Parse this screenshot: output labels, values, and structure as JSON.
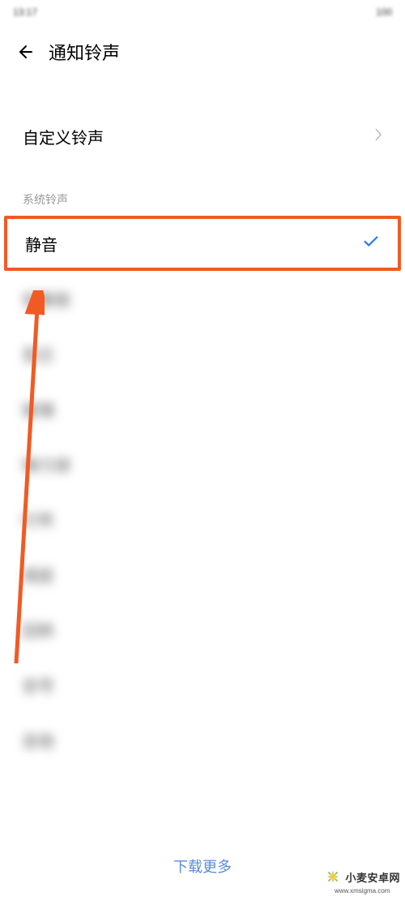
{
  "statusbar": {
    "time": "13:17",
    "right": "100"
  },
  "header": {
    "title": "通知铃声"
  },
  "custom": {
    "label": "自定义铃声"
  },
  "section": {
    "title": "系统铃声"
  },
  "ringtones": [
    {
      "name": "静音",
      "selected": true,
      "blurred": false
    },
    {
      "name": "安静旅",
      "selected": false,
      "blurred": true
    },
    {
      "name": "变迁",
      "selected": false,
      "blurred": true
    },
    {
      "name": "玻璃",
      "selected": false,
      "blurred": true
    },
    {
      "name": "弹力球",
      "selected": false,
      "blurred": true
    },
    {
      "name": "叮咚",
      "selected": false,
      "blurred": true
    },
    {
      "name": "调皮",
      "selected": false,
      "blurred": true
    },
    {
      "name": "回转",
      "selected": false,
      "blurred": true
    },
    {
      "name": "吉号",
      "selected": false,
      "blurred": true
    },
    {
      "name": "吉他",
      "selected": false,
      "blurred": true
    }
  ],
  "bottom": {
    "download_more": "下载更多"
  },
  "watermark": {
    "text": "小麦安卓网",
    "url": "www.xmsigma.com"
  }
}
